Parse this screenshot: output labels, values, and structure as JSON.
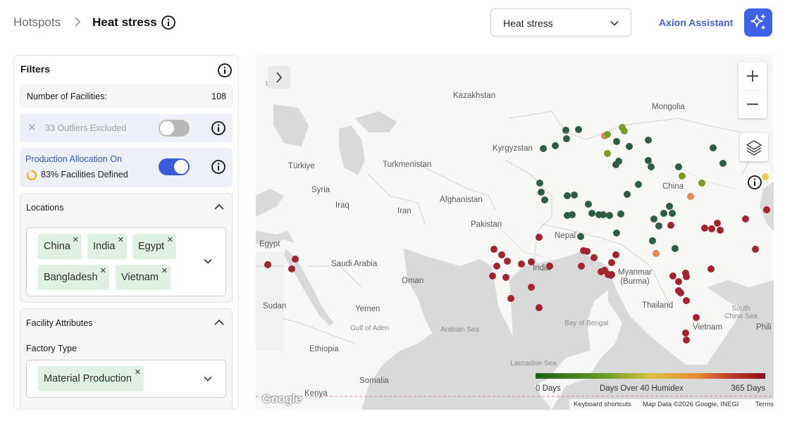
{
  "header": {
    "breadcrumb_parent": "Hotspots",
    "breadcrumb_current": "Heat stress",
    "metric_select_value": "Heat stress",
    "assistant_label": "Axion Assistant"
  },
  "filters": {
    "title": "Filters",
    "facility_count_label": "Number of Facilities:",
    "facility_count_value": "108",
    "outliers_label": "33 Outliers Excluded",
    "outliers_toggle_on": false,
    "allocation_label": "Production Allocation On",
    "allocation_toggle_on": true,
    "facilities_defined": "83% Facilities Defined",
    "facilities_defined_fraction": 0.83,
    "locations": {
      "title": "Locations",
      "chips": [
        "China",
        "India",
        "Egypt",
        "Bangladesh",
        "Vietnam"
      ]
    },
    "facility_attributes": {
      "title": "Facility Attributes",
      "factory_type_label": "Factory Type",
      "factory_type_chips": [
        "Material Production"
      ]
    }
  },
  "map": {
    "labels": {
      "kazakhstan": "Kazakhstan",
      "mongolia": "Mongolia",
      "kyrgyzstan": "Kyrgyzstan",
      "turkmenistan": "Turkmenistan",
      "turkiye": "Türkiye",
      "syria": "Syria",
      "iraq": "Iraq",
      "iran": "Iran",
      "afghanistan": "Afghanistan",
      "pakistan": "Pakistan",
      "china": "China",
      "nepal": "Nepal",
      "india": "India",
      "egypt": "Egypt",
      "saudi_arabia": "Saudi Arabia",
      "oman": "Oman",
      "myanmar": "Myanmar\n(Burma)",
      "thailand": "Thailand",
      "vietnam": "Vietnam",
      "sudan": "Sudan",
      "yemen": "Yemen",
      "ethiopia": "Ethiopia",
      "somalia": "Somalia",
      "kenya": "Kenya",
      "south_china_sea": "South\nChina Sea",
      "arabian_sea": "Arabian Sea",
      "bay_of_bengal": "Bay of Bengal",
      "gulf_of_aden": "Gulf of Aden",
      "laccadive_sea": "Laccadive Sea",
      "phili": "Phili",
      "u": "U"
    },
    "legend": {
      "min_label": "0 Days",
      "title": "Days Over 40 Humidex",
      "max_label": "365 Days"
    },
    "attribution": {
      "keyboard": "Keyboard shortcuts",
      "data": "Map Data ©2026 Google, INEGI",
      "terms": "Terms",
      "logo": "Google"
    },
    "colors": {
      "low": "#2f5d44",
      "low_mid": "#7a9c2a",
      "mid": "#e48a56",
      "high": "#a3242e"
    }
  }
}
